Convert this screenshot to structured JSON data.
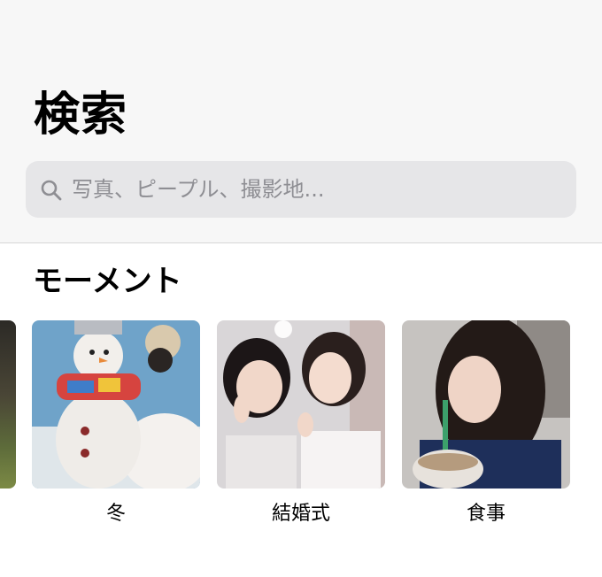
{
  "header": {
    "title": "検索",
    "search": {
      "placeholder": "写真、ピープル、撮影地...",
      "icon": "search-icon"
    }
  },
  "moments": {
    "section_title": "モーメント",
    "items": [
      {
        "label": "冬"
      },
      {
        "label": "結婚式"
      },
      {
        "label": "食事"
      }
    ]
  }
}
